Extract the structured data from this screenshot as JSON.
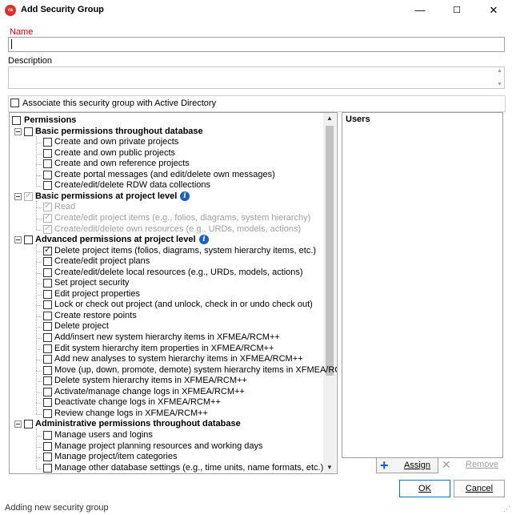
{
  "window": {
    "title": "Add Security Group",
    "app_icon_text": "ra",
    "minimize_glyph": "—",
    "maximize_glyph": "☐",
    "close_glyph": "✕"
  },
  "form": {
    "name_label": "Name",
    "name_value": "",
    "description_label": "Description",
    "description_value": "",
    "ad_label": "Associate this security group with Active Directory",
    "ad_checked": false
  },
  "permissions": {
    "header": "Permissions",
    "groups": [
      {
        "label": "Basic permissions throughout database",
        "info": false,
        "state": "unchecked",
        "items": [
          {
            "label": "Create and own private projects",
            "checked": false,
            "disabled": false
          },
          {
            "label": "Create and own public projects",
            "checked": false,
            "disabled": false
          },
          {
            "label": "Create and own reference projects",
            "checked": false,
            "disabled": false
          },
          {
            "label": "Create portal messages (and edit/delete own messages)",
            "checked": false,
            "disabled": false
          },
          {
            "label": "Create/edit/delete RDW data collections",
            "checked": false,
            "disabled": false
          }
        ]
      },
      {
        "label": "Basic permissions at project level",
        "info": true,
        "state": "checked-disabled",
        "items": [
          {
            "label": "Read",
            "checked": true,
            "disabled": true
          },
          {
            "label": "Create/edit project items (e.g., folios, diagrams, system hierarchy)",
            "checked": true,
            "disabled": true
          },
          {
            "label": "Create/edit/delete own resources (e.g., URDs, models, actions)",
            "checked": true,
            "disabled": true
          }
        ]
      },
      {
        "label": "Advanced permissions at project level",
        "info": true,
        "state": "unchecked",
        "items": [
          {
            "label": "Delete project items (folios, diagrams, system hierarchy items, etc.)",
            "checked": true,
            "disabled": false
          },
          {
            "label": "Create/edit project plans",
            "checked": false,
            "disabled": false
          },
          {
            "label": "Create/edit/delete local resources (e.g., URDs, models, actions)",
            "checked": false,
            "disabled": false
          },
          {
            "label": "Set project security",
            "checked": false,
            "disabled": false
          },
          {
            "label": "Edit project properties",
            "checked": false,
            "disabled": false
          },
          {
            "label": "Lock or check out project (and unlock, check in or undo check out)",
            "checked": false,
            "disabled": false
          },
          {
            "label": "Create restore points",
            "checked": false,
            "disabled": false
          },
          {
            "label": "Delete project",
            "checked": false,
            "disabled": false
          },
          {
            "label": "Add/insert new system hierarchy items in XFMEA/RCM++",
            "checked": false,
            "disabled": false
          },
          {
            "label": "Edit system hierarchy item properties in XFMEA/RCM++",
            "checked": false,
            "disabled": false
          },
          {
            "label": "Add new analyses to system hierarchy items in XFMEA/RCM++",
            "checked": false,
            "disabled": false
          },
          {
            "label": "Move (up, down, promote, demote) system hierarchy items in XFMEA/RCM++",
            "checked": false,
            "disabled": false
          },
          {
            "label": "Delete system hierarchy items in XFMEA/RCM++",
            "checked": false,
            "disabled": false
          },
          {
            "label": "Activate/manage change logs in XFMEA/RCM++",
            "checked": false,
            "disabled": false
          },
          {
            "label": "Deactivate change logs in XFMEA/RCM++",
            "checked": false,
            "disabled": false
          },
          {
            "label": "Review change logs in XFMEA/RCM++",
            "checked": false,
            "disabled": false
          }
        ]
      },
      {
        "label": "Administrative permissions throughout database",
        "info": false,
        "state": "unchecked",
        "items": [
          {
            "label": "Manage users and logins",
            "checked": false,
            "disabled": false
          },
          {
            "label": "Manage project planning resources and working days",
            "checked": false,
            "disabled": false
          },
          {
            "label": "Manage project/item categories",
            "checked": false,
            "disabled": false
          },
          {
            "label": "Manage other database settings (e.g., time units, name formats, etc.)",
            "checked": false,
            "disabled": false
          }
        ]
      }
    ]
  },
  "users": {
    "header": "Users",
    "assign_label": "Assign",
    "remove_label": "Remove"
  },
  "buttons": {
    "ok_label": "OK",
    "cancel_label": "Cancel"
  },
  "status": {
    "text": "Adding new security group"
  },
  "icons": {
    "info": "info-icon",
    "plus": "plus-icon",
    "remove": "x-icon"
  },
  "colors": {
    "required_label": "#e00000",
    "info_blue": "#1a5fc8",
    "disabled_text": "#a0a0a0"
  }
}
